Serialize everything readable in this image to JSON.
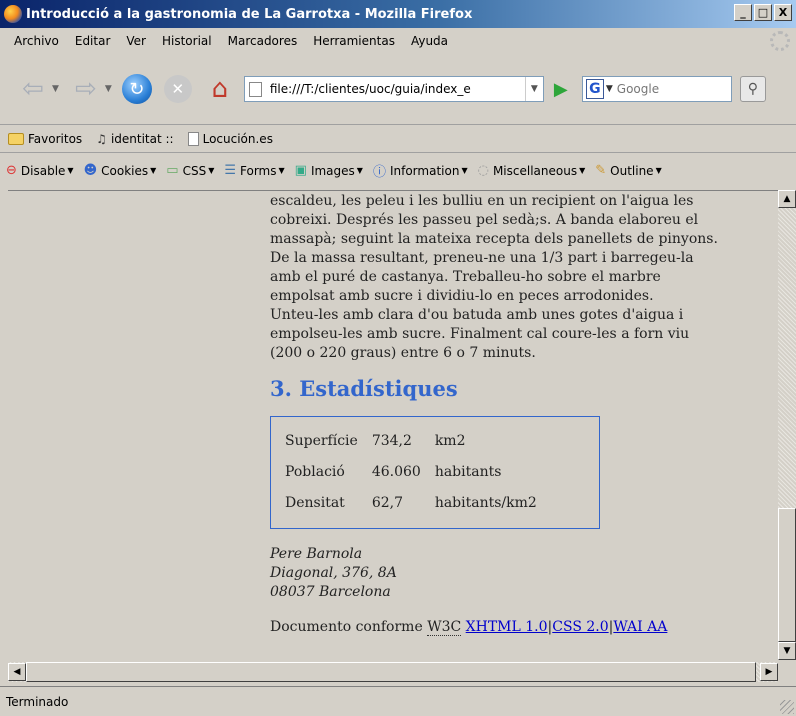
{
  "window": {
    "title": "Introducció a la gastronomia de La Garrotxa - Mozilla Firefox",
    "controls": {
      "minimize": "_",
      "maximize": "□",
      "close": "X"
    }
  },
  "menu": [
    "Archivo",
    "Editar",
    "Ver",
    "Historial",
    "Marcadores",
    "Herramientas",
    "Ayuda"
  ],
  "navigation": {
    "url": "file:///T:/clientes/uoc/guia/index_e",
    "search_placeholder": "Google"
  },
  "bookmarks": [
    "Favoritos",
    "identitat ::",
    "Locución.es"
  ],
  "devbar": [
    "Disable",
    "Cookies",
    "CSS",
    "Forms",
    "Images",
    "Information",
    "Miscellaneous",
    "Outline"
  ],
  "page": {
    "paragraph_lines": [
      "escaldeu, les peleu i les bulliu en un recipient on l'aigua les",
      "cobreixi. Després les passeu pel sedà;s. A banda elaboreu el",
      "massapà; seguint la mateixa recepta dels panellets de pinyons.",
      "De la massa resultant, preneu-ne una 1/3 part i barregeu-la",
      "amb el puré de castanya. Treballeu-ho sobre el marbre",
      "empolsat amb sucre i dividiu-lo en peces arrodonides.",
      "Unteu-les amb clara d'ou batuda amb unes gotes d'aigua i",
      "empolseu-les amb sucre. Finalment cal coure-les a forn viu",
      "(200 o 220 graus) entre 6 o 7 minuts."
    ],
    "section_heading": "3. Estadístiques",
    "stats": [
      {
        "label": "Superfície",
        "value": "734,2",
        "unit": "km2"
      },
      {
        "label": "Població",
        "value": "46.060",
        "unit": "habitants"
      },
      {
        "label": "Densitat",
        "value": "62,7",
        "unit": "habitants/km2"
      }
    ],
    "address": [
      "Pere Barnola",
      "Diagonal, 376, 8A",
      "08037 Barcelona"
    ],
    "conform_text": "Documento conforme",
    "w3c": "W3C",
    "links": [
      "XHTML 1.0",
      "CSS 2.0",
      "WAI AA"
    ]
  },
  "status": "Terminado"
}
